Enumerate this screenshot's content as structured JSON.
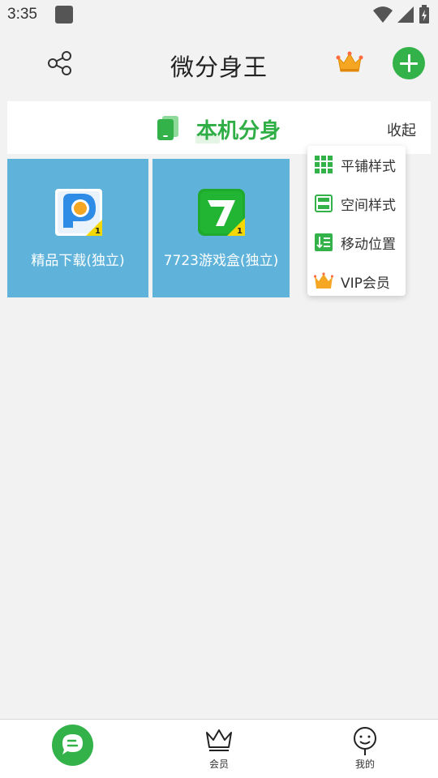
{
  "status_bar": {
    "time": "3:35"
  },
  "header": {
    "title": "微分身王"
  },
  "section": {
    "title": "本机分身",
    "collapse_label": "收起"
  },
  "apps": [
    {
      "label": "精品下载(独立)",
      "badge": "1",
      "icon": "pp-download-icon"
    },
    {
      "label": "7723游戏盒(独立)",
      "badge": "1",
      "icon": "7723-game-box-icon"
    }
  ],
  "menu": {
    "items": [
      {
        "label": "平铺样式",
        "icon": "grid-icon"
      },
      {
        "label": "空间样式",
        "icon": "stack-icon"
      },
      {
        "label": "移动位置",
        "icon": "move-icon"
      },
      {
        "label": "VIP会员",
        "icon": "crown-icon"
      }
    ]
  },
  "bottom_nav": {
    "items": [
      {
        "label": "",
        "icon": "chat-icon"
      },
      {
        "label": "会员",
        "icon": "crown-outline-icon"
      },
      {
        "label": "我的",
        "icon": "person-icon"
      }
    ]
  },
  "colors": {
    "accent": "#33b24a",
    "tile": "#5fb3db",
    "crown": "#f5a623"
  }
}
